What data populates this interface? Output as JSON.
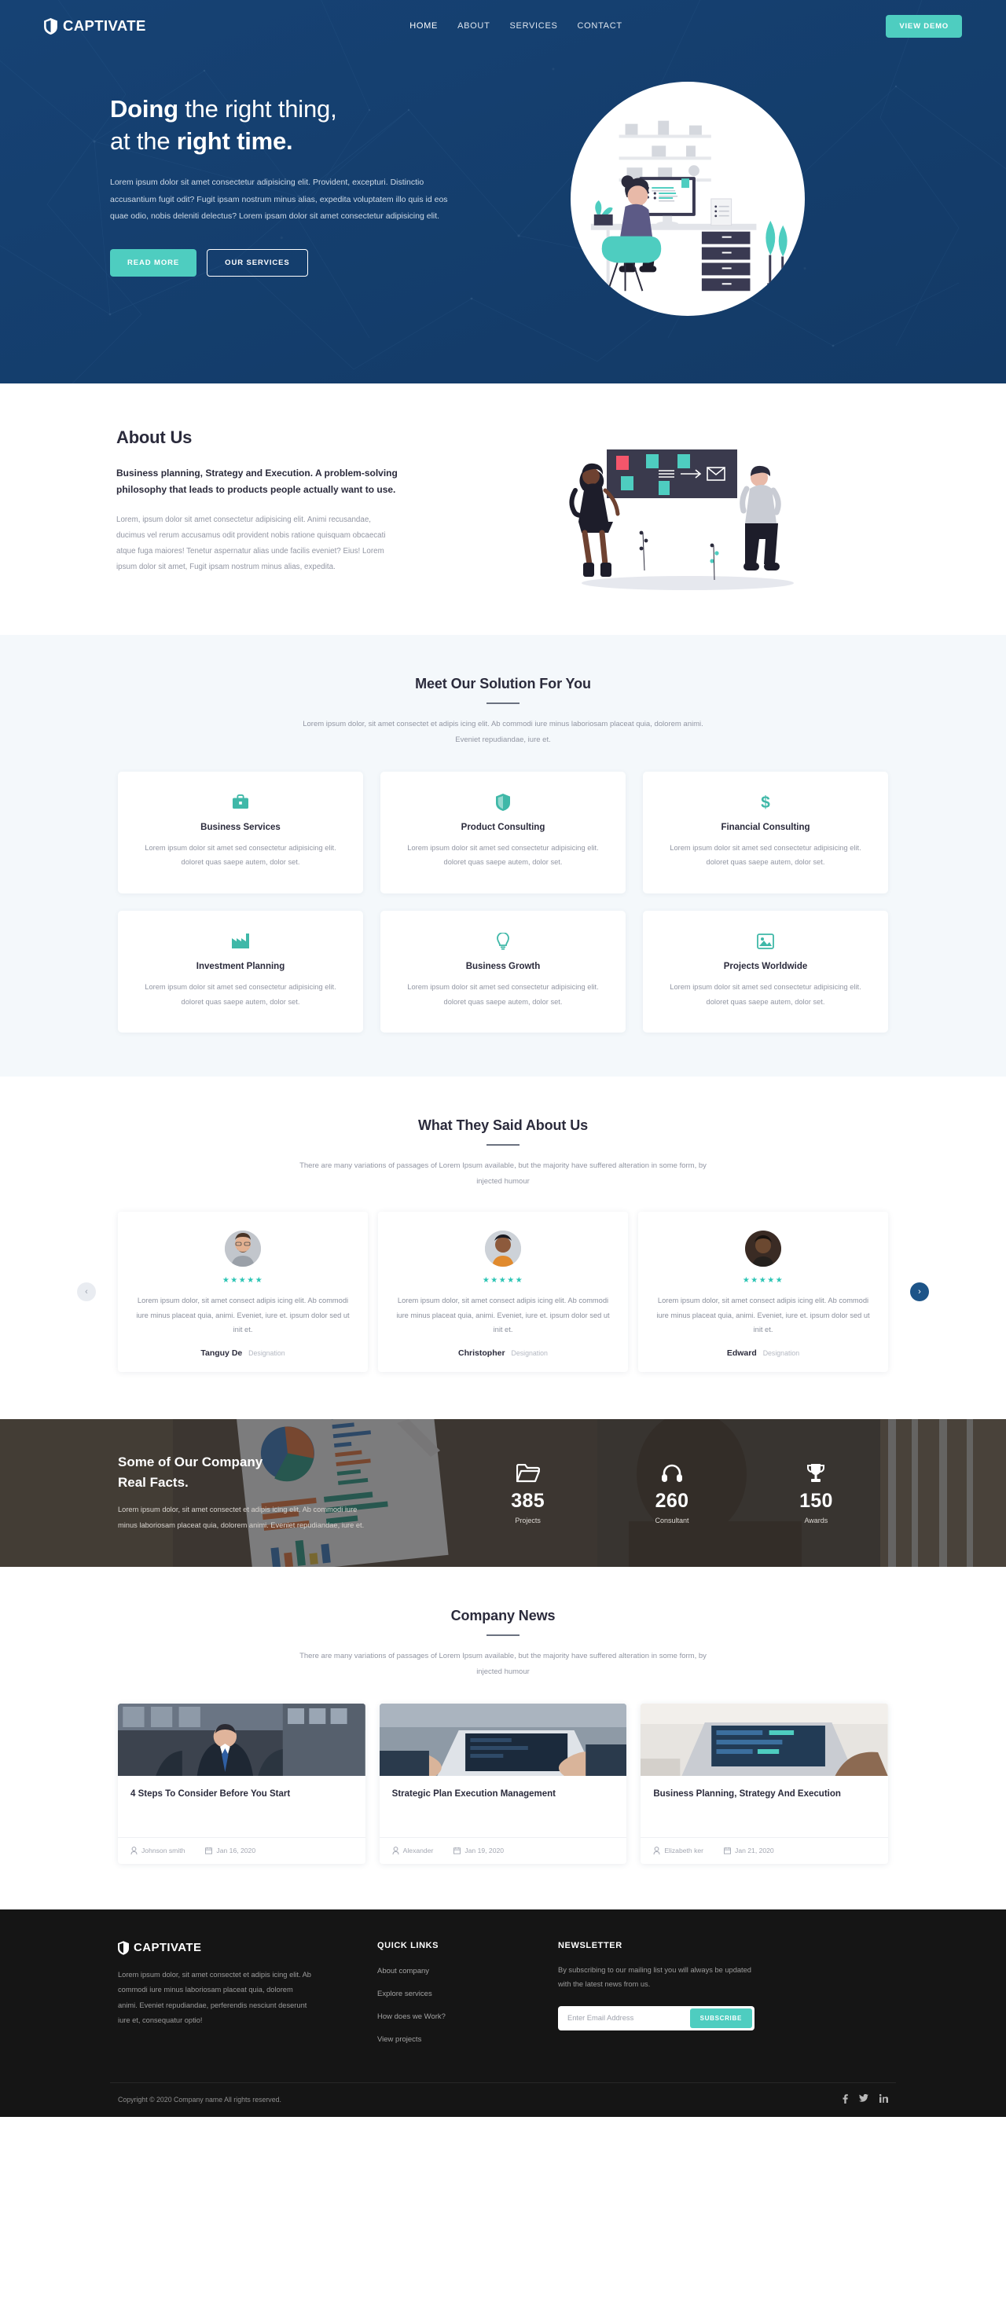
{
  "brand": {
    "name": "CAPTIVATE",
    "icon": "shield-icon"
  },
  "nav": {
    "items": [
      {
        "label": "HOME",
        "active": true
      },
      {
        "label": "ABOUT",
        "active": false
      },
      {
        "label": "SERVICES",
        "active": false
      },
      {
        "label": "CONTACT",
        "active": false
      }
    ],
    "cta": "VIEW DEMO"
  },
  "hero": {
    "title_line1_bold": "Doing",
    "title_line1_rest": " the right thing,",
    "title_line2_rest": "at the ",
    "title_line2_bold": "right time.",
    "paragraph": "Lorem ipsum dolor sit amet consectetur adipisicing elit. Provident, excepturi. Distinctio accusantium fugit odit? Fugit ipsam nostrum minus alias, expedita voluptatem illo quis id eos quae odio, nobis deleniti delectus? Lorem ipsam dolor sit amet consectetur adipisicing elit.",
    "btn_primary": "READ MORE",
    "btn_secondary": "OUR SERVICES",
    "illustration": "woman-at-desk-illustration"
  },
  "about": {
    "heading": "About Us",
    "subheading": "Business planning, Strategy and Execution. A problem-solving philosophy that leads to products people actually want to use.",
    "paragraph": "Lorem, ipsum dolor sit amet consectetur adipisicing elit. Animi recusandae, ducimus vel rerum accusamus odit provident nobis ratione quisquam obcaecati atque fuga maiores! Tenetur aspernatur alias unde facilis eveniet? Eius! Lorem ipsum dolor sit amet, Fugit ipsam nostrum minus alias, expedita.",
    "illustration": "two-people-whiteboard-illustration"
  },
  "solutions": {
    "title": "Meet Our Solution For You",
    "subtitle": "Lorem ipsum dolor, sit amet consectet et adipis icing elit. Ab commodi iure minus laboriosam placeat quia, dolorem animi. Eveniet repudiandae, iure et.",
    "cards": [
      {
        "icon": "briefcase-icon",
        "title": "Business Services",
        "text": "Lorem ipsum dolor sit amet sed consectetur adipisicing elit. doloret quas saepe autem, dolor set."
      },
      {
        "icon": "shield-icon",
        "title": "Product Consulting",
        "text": "Lorem ipsum dolor sit amet sed consectetur adipisicing elit. doloret quas saepe autem, dolor set."
      },
      {
        "icon": "dollar-icon",
        "title": "Financial Consulting",
        "text": "Lorem ipsum dolor sit amet sed consectetur adipisicing elit. doloret quas saepe autem, dolor set."
      },
      {
        "icon": "factory-icon",
        "title": "Investment Planning",
        "text": "Lorem ipsum dolor sit amet sed consectetur adipisicing elit. doloret quas saepe autem, dolor set."
      },
      {
        "icon": "lightbulb-icon",
        "title": "Business Growth",
        "text": "Lorem ipsum dolor sit amet sed consectetur adipisicing elit. doloret quas saepe autem, dolor set."
      },
      {
        "icon": "image-icon",
        "title": "Projects Worldwide",
        "text": "Lorem ipsum dolor sit amet sed consectetur adipisicing elit. doloret quas saepe autem, dolor set."
      }
    ]
  },
  "testimonials": {
    "title": "What They Said About Us",
    "subtitle": "There are many variations of passages of Lorem Ipsum available, but the majority have suffered alteration in some form, by injected humour",
    "stars": "★★★★★",
    "items": [
      {
        "name": "Tanguy De",
        "role": "Designation",
        "text": "Lorem ipsum dolor, sit amet consect adipis icing elit. Ab commodi iure minus placeat quia, animi. Eveniet, iure et. ipsum dolor sed ut init et."
      },
      {
        "name": "Christopher",
        "role": "Designation",
        "text": "Lorem ipsum dolor, sit amet consect adipis icing elit. Ab commodi iure minus placeat quia, animi. Eveniet, iure et. ipsum dolor sed ut init et."
      },
      {
        "name": "Edward",
        "role": "Designation",
        "text": "Lorem ipsum dolor, sit amet consect adipis icing elit. Ab commodi iure minus placeat quia, animi. Eveniet, iure et. ipsum dolor sed ut init et."
      }
    ],
    "prev_label": "‹",
    "next_label": "›"
  },
  "facts": {
    "title_line1": "Some of Our Company",
    "title_line2": "Real Facts.",
    "text": "Lorem ipsum dolor, sit amet consectet et adipis icing elit. Ab commodi iure minus laboriosam placeat quia, dolorem animi. Eveniet repudiandae, iure et.",
    "stats": [
      {
        "icon": "folder-icon",
        "value": "385",
        "label": "Projects"
      },
      {
        "icon": "headset-icon",
        "value": "260",
        "label": "Consultant"
      },
      {
        "icon": "trophy-icon",
        "value": "150",
        "label": "Awards"
      }
    ]
  },
  "news": {
    "title": "Company News",
    "subtitle": "There are many variations of passages of Lorem Ipsum available, but the majority have suffered alteration in some form, by injected humour",
    "items": [
      {
        "title": "4 Steps To Consider Before You Start",
        "author": "Johnson smith",
        "date": "Jan 16, 2020",
        "thumb": "businessman-handshake-photo"
      },
      {
        "title": "Strategic Plan Execution Management",
        "author": "Alexander",
        "date": "Jan 19, 2020",
        "thumb": "hands-on-laptop-photo"
      },
      {
        "title": "Business Planning, Strategy And Execution",
        "author": "Elizabeth ker",
        "date": "Jan 21, 2020",
        "thumb": "laptop-desk-photo"
      }
    ]
  },
  "footer": {
    "brand": "CAPTIVATE",
    "description": "Lorem ipsum dolor, sit amet consectet et adipis icing elit. Ab commodi iure minus laboriosam placeat quia, dolorem animi. Eveniet repudiandae, perferendis nesciunt deserunt iure et, consequatur optio!",
    "quick_links_title": "QUICK LINKS",
    "quick_links": [
      "About company",
      "Explore services",
      "How does we Work?",
      "View projects"
    ],
    "newsletter_title": "NEWSLETTER",
    "newsletter_text": "By subscribing to our mailing list you will always be updated with the latest news from us.",
    "email_placeholder": "Enter Email Address",
    "email_value": "",
    "subscribe_label": "SUBSCRIBE",
    "copyright": "Copyright © 2020 Company name All rights reserved.",
    "socials": [
      {
        "name": "facebook-icon",
        "glyph": "f"
      },
      {
        "name": "twitter-icon",
        "glyph": "🐦"
      },
      {
        "name": "linkedin-icon",
        "glyph": "in"
      }
    ]
  },
  "colors": {
    "accent": "#4ecdc0",
    "navy": "#154273",
    "dark": "#151515",
    "muted": "#9296a3"
  }
}
